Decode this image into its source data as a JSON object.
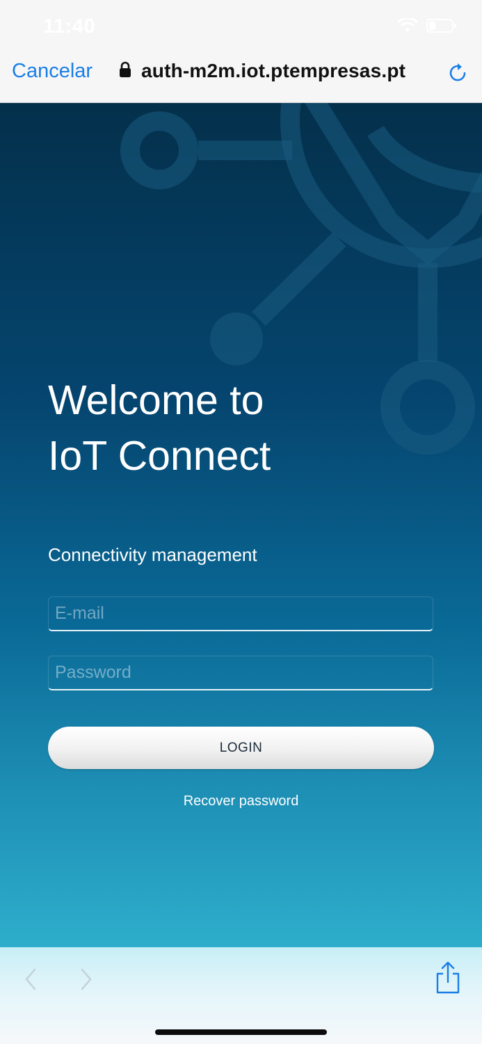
{
  "status_bar": {
    "time": "11:40",
    "icons": [
      "wifi-icon",
      "battery-icon"
    ]
  },
  "browser": {
    "cancel_label": "Cancelar",
    "url": "auth-m2m.iot.ptempresas.pt",
    "icons": [
      "lock-icon",
      "reload-icon"
    ]
  },
  "login": {
    "welcome_line1": "Welcome to",
    "welcome_line2": "IoT Connect",
    "subtitle": "Connectivity management",
    "email_placeholder": "E-mail",
    "email_value": "",
    "password_placeholder": "Password",
    "password_value": "",
    "login_label": "LOGIN",
    "recover_label": "Recover password"
  },
  "toolbar": {
    "icons": [
      "chevron-left-icon",
      "chevron-right-icon",
      "share-icon"
    ]
  },
  "colors": {
    "accent": "#1a7ee6",
    "background_top": "#04304b",
    "background_bottom": "#2eaecb"
  }
}
